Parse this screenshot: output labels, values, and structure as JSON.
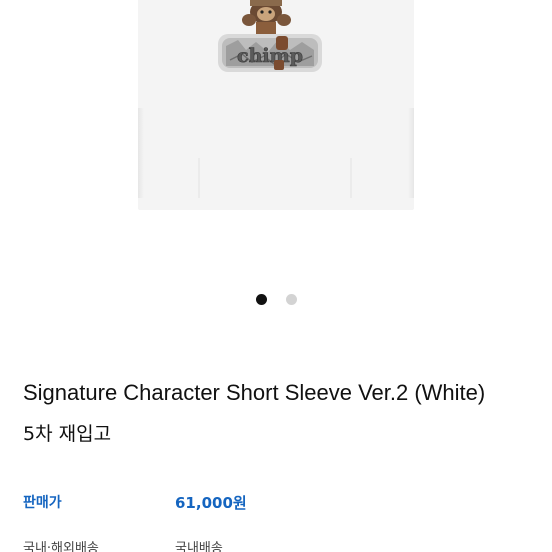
{
  "product_image": {
    "graphic_text": "chimp",
    "shirt_color": "#f4f4f4"
  },
  "carousel": {
    "total": 2,
    "active_index": 1,
    "active_color": "#111111",
    "inactive_color": "#d3d3d3"
  },
  "product": {
    "title": "Signature Character Short Sleeve Ver.2 (White)",
    "subtitle": "5차 재입고"
  },
  "details": {
    "price_label": "판매가",
    "price_value": "61,000원",
    "shipping_label": "국내·해외배송",
    "shipping_value": "국내배송"
  },
  "colors": {
    "accent": "#1565c0",
    "text": "#111111"
  }
}
